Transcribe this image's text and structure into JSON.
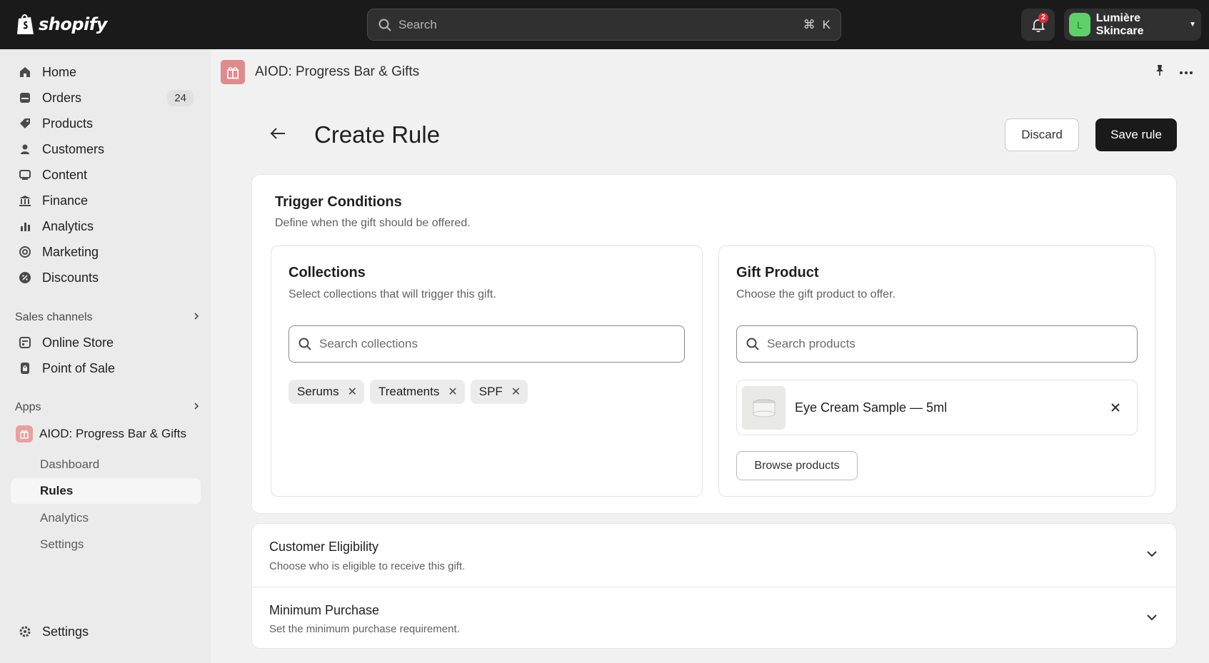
{
  "topbar": {
    "logo_text": "shopify",
    "search_placeholder": "Search",
    "shortcut_cmd": "⌘",
    "shortcut_key": "K",
    "notification_count": "2",
    "store_avatar_letter": "L",
    "store_name": "Lumière Skincare",
    "avatar_color": "#5fd16b"
  },
  "sidebar": {
    "items": [
      {
        "label": "Home",
        "icon": "home-icon"
      },
      {
        "label": "Orders",
        "icon": "orders-icon",
        "count": "24"
      },
      {
        "label": "Products",
        "icon": "tag-icon"
      },
      {
        "label": "Customers",
        "icon": "person-icon"
      },
      {
        "label": "Content",
        "icon": "content-icon"
      },
      {
        "label": "Finance",
        "icon": "bank-icon"
      },
      {
        "label": "Analytics",
        "icon": "bar-chart-icon"
      },
      {
        "label": "Marketing",
        "icon": "target-icon"
      },
      {
        "label": "Discounts",
        "icon": "discount-icon"
      }
    ],
    "sales_channels_label": "Sales channels",
    "channels": [
      {
        "label": "Online Store",
        "icon": "store-icon"
      },
      {
        "label": "Point of Sale",
        "icon": "pos-icon"
      }
    ],
    "apps_label": "Apps",
    "app_name": "AIOD: Progress Bar & Gifts",
    "app_sub_items": [
      "Dashboard",
      "Rules",
      "Analytics",
      "Settings"
    ],
    "active_sub_item": "Rules",
    "settings_label": "Settings"
  },
  "app_header": {
    "title": "AIOD: Progress Bar & Gifts"
  },
  "page": {
    "title": "Create Rule",
    "discard_label": "Discard",
    "save_label": "Save rule"
  },
  "trigger": {
    "title": "Trigger Conditions",
    "subtitle": "Define when the gift should be offered.",
    "collections": {
      "title": "Collections",
      "subtitle": "Select collections that will trigger this gift.",
      "search_placeholder": "Search collections",
      "tags": [
        "Serums",
        "Treatments",
        "SPF"
      ]
    },
    "gift": {
      "title": "Gift Product",
      "subtitle": "Choose the gift product to offer.",
      "search_placeholder": "Search products",
      "selected_product": "Eye Cream Sample — 5ml",
      "browse_label": "Browse products"
    }
  },
  "accordion": {
    "sections": [
      {
        "title": "Customer Eligibility",
        "subtitle": "Choose who is eligible to receive this gift."
      },
      {
        "title": "Minimum Purchase",
        "subtitle": "Set the minimum purchase requirement."
      }
    ]
  }
}
